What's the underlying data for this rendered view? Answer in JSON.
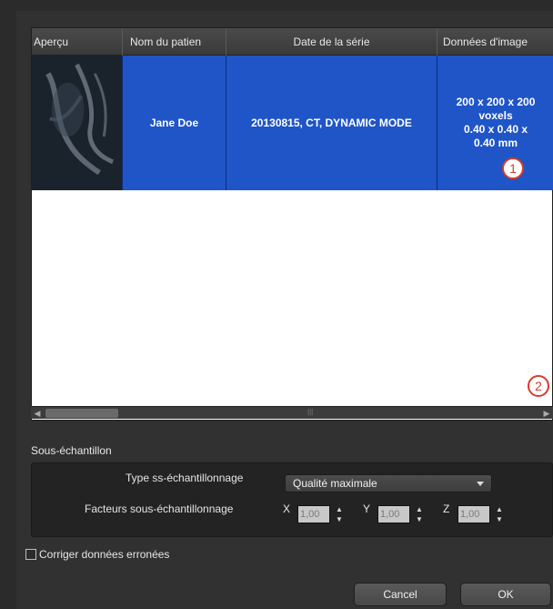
{
  "table": {
    "columns": [
      "Aperçu",
      "Nom du patien",
      "Date de la série",
      "Données d'image"
    ],
    "rows": [
      {
        "patient": "Jane Doe",
        "series_date": "20130815, CT, DYNAMIC MODE",
        "image_data_line1": "200 x 200 x 200",
        "image_data_line2": "voxels",
        "image_data_line3": "0.40 x 0.40 x",
        "image_data_line4": "0.40 mm"
      }
    ]
  },
  "callouts": {
    "one": "1",
    "two": "2"
  },
  "subsample": {
    "section_title": "Sous-échantillon",
    "type_label": "Type ss-échantillonnage",
    "type_value": "Qualité maximale",
    "factors_label": "Facteurs sous-échantillonnage",
    "x_label": "X",
    "x_value": "1,00",
    "y_label": "Y",
    "y_value": "1,00",
    "z_label": "Z",
    "z_value": "1,00"
  },
  "options": {
    "fix_erroneous_label": "Corriger données erronées",
    "fix_erroneous_checked": false
  },
  "buttons": {
    "cancel": "Cancel",
    "ok": "OK"
  },
  "colors": {
    "selection": "#1f55c7",
    "callout": "#d93a2b"
  }
}
